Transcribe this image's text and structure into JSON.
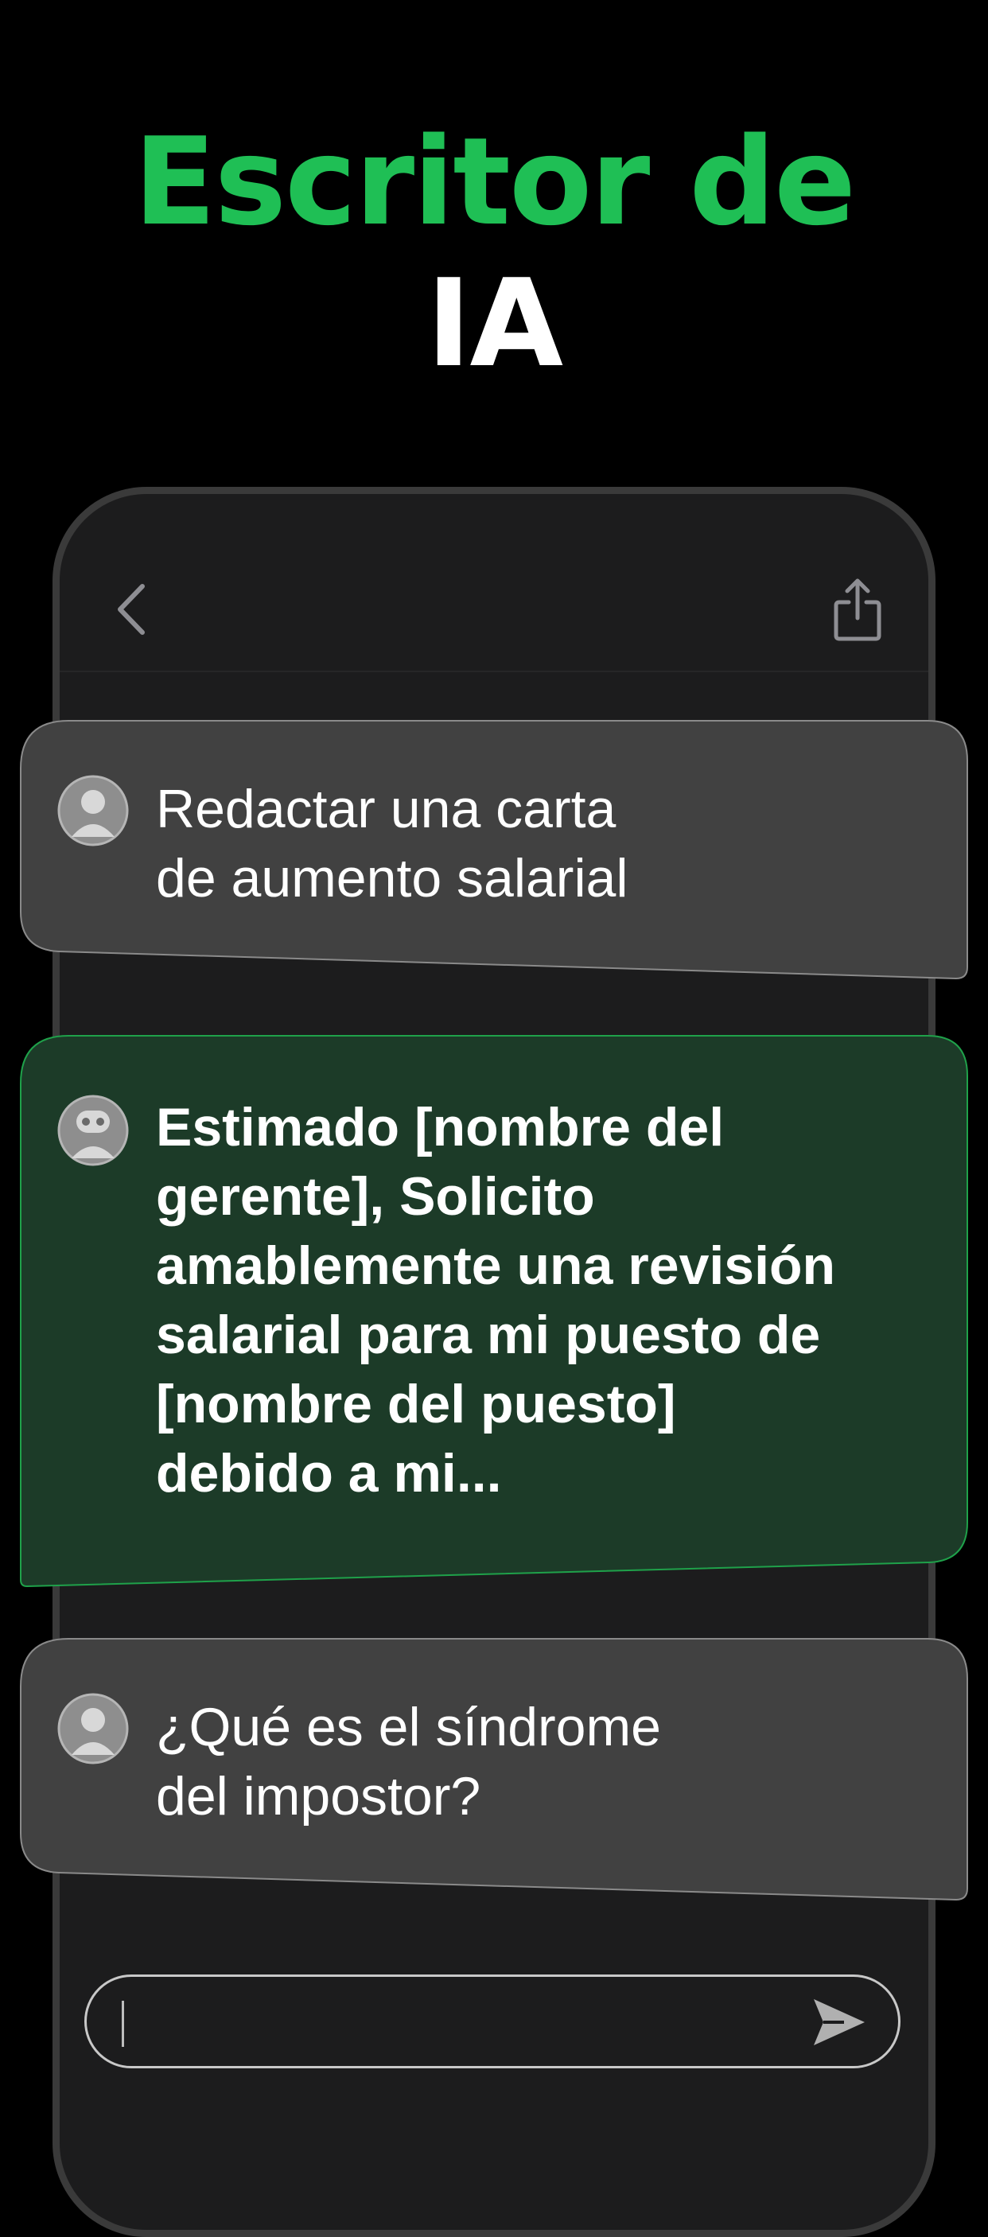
{
  "hero": {
    "title_line1": "Escritor de",
    "title_line2": "IA"
  },
  "header": {
    "back_icon": "chevron-left-icon",
    "share_icon": "share-icon"
  },
  "messages": [
    {
      "role": "user",
      "avatar_icon": "user-avatar-icon",
      "lines": [
        "Redactar una carta",
        "de aumento salarial"
      ]
    },
    {
      "role": "assistant",
      "avatar_icon": "robot-avatar-icon",
      "lines": [
        "Estimado [nombre del",
        "gerente], Solicito",
        "amablemente una revisión",
        "salarial para mi puesto de",
        "[nombre del puesto]",
        "debido a mi..."
      ]
    },
    {
      "role": "user",
      "avatar_icon": "user-avatar-icon",
      "lines": [
        "¿Qué es el síndrome",
        "del impostor?"
      ]
    }
  ],
  "composer": {
    "value": "",
    "send_icon": "send-icon"
  },
  "colors": {
    "accent_green": "#1fbf55",
    "assistant_bubble": "#1c3b28",
    "user_bubble": "#414141",
    "background": "#000000"
  }
}
